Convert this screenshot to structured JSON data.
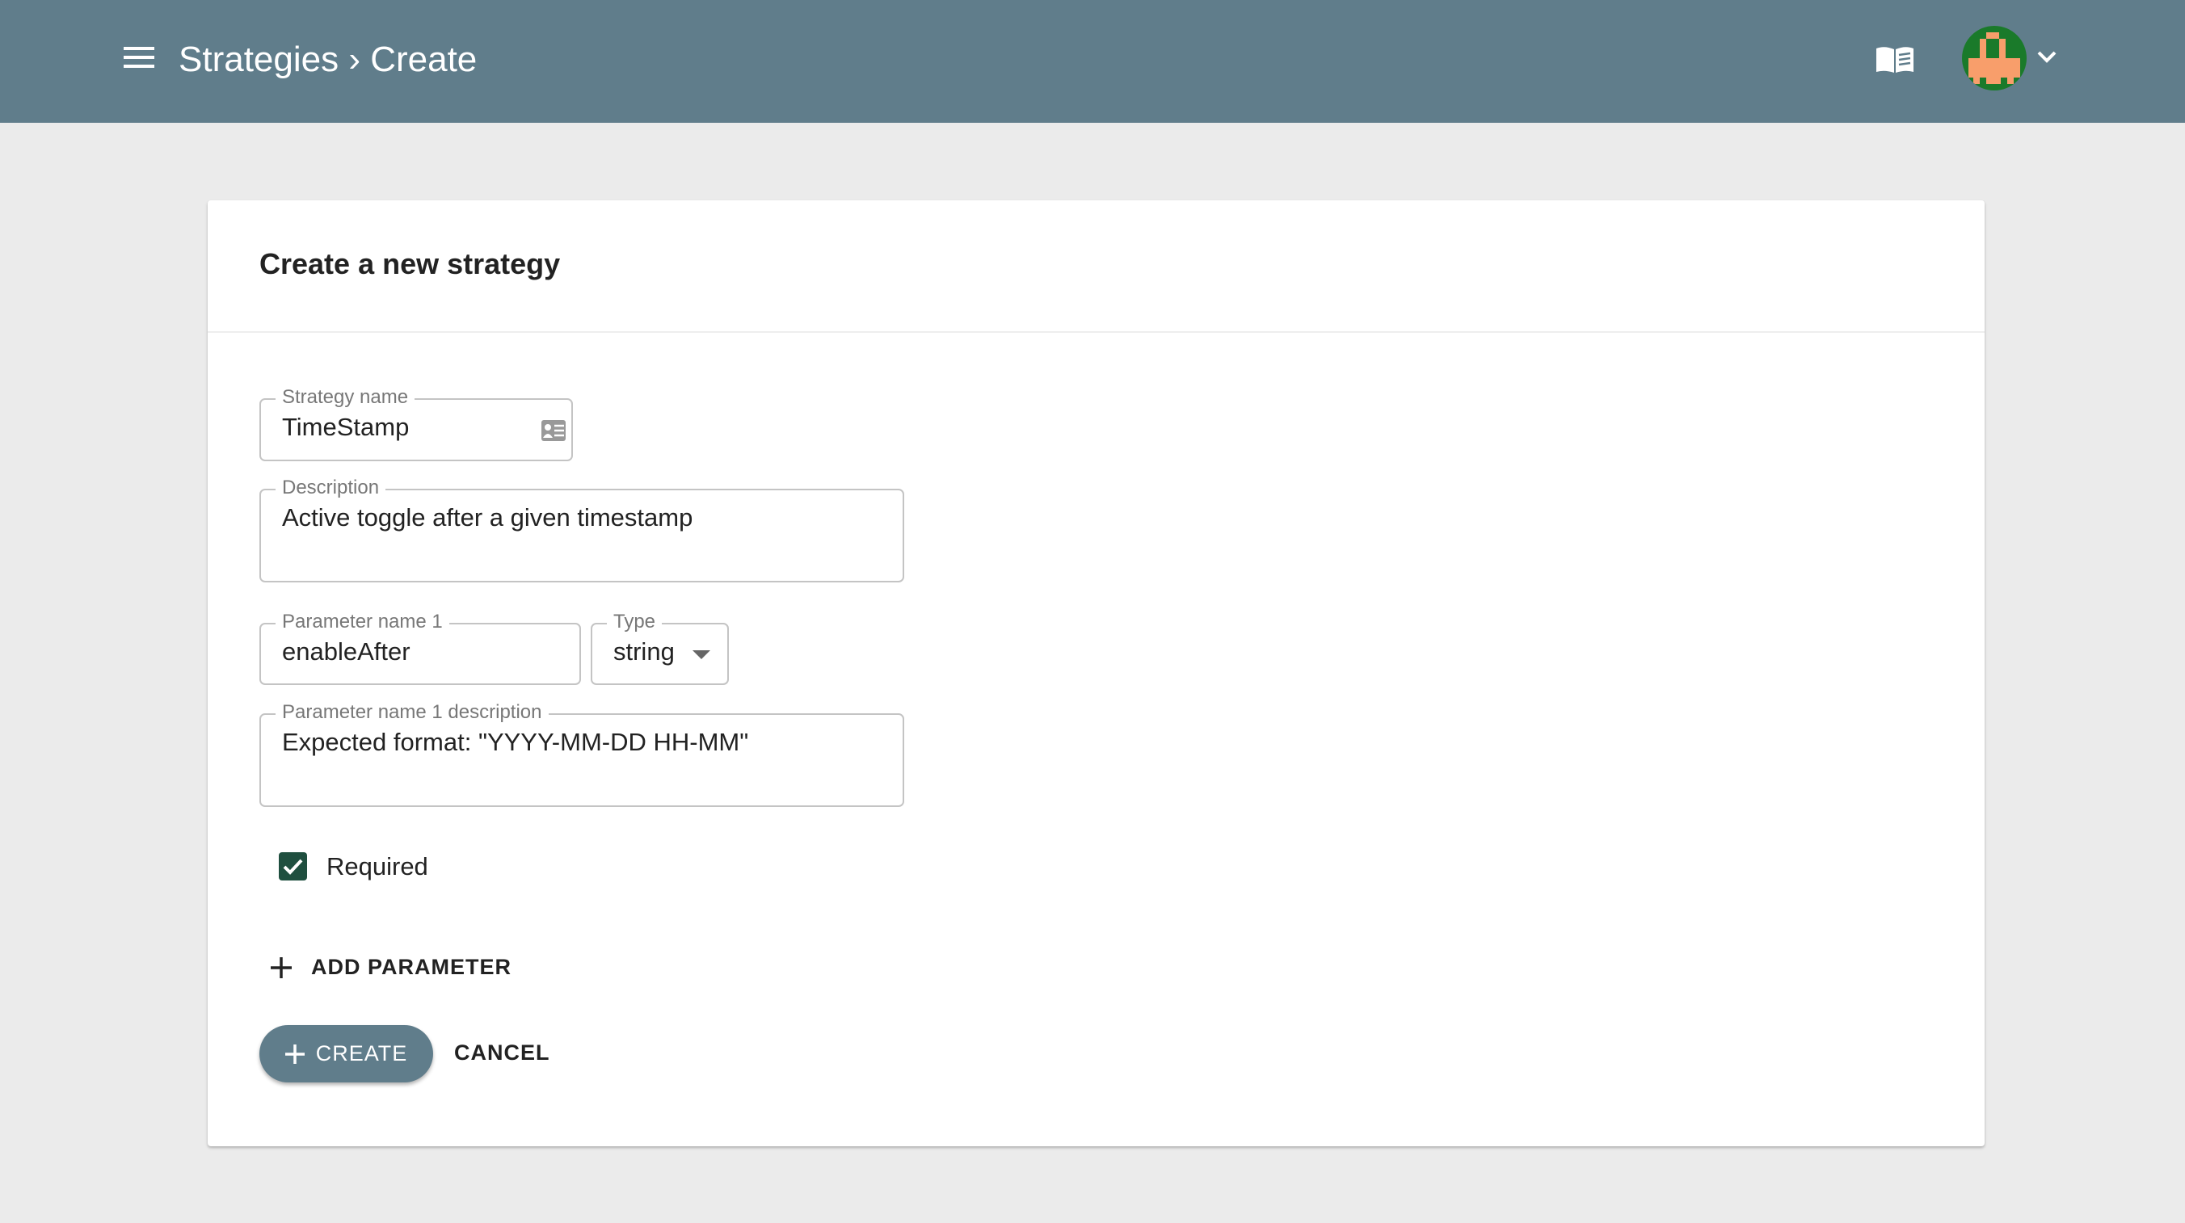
{
  "header": {
    "breadcrumb": "Strategies › Create",
    "menu_icon": "hamburger-icon",
    "docs_icon": "book-icon",
    "avatar_colors": {
      "bg": "#1a7a2a",
      "fg": "#f89e6b"
    }
  },
  "colors": {
    "primary": "#607d8b",
    "checkbox": "#1f4f3f",
    "background": "#ebebeb"
  },
  "card": {
    "title": "Create a new strategy"
  },
  "form": {
    "strategy_name": {
      "label": "Strategy name",
      "value": "TimeStamp"
    },
    "description": {
      "label": "Description",
      "value": "Active toggle after a given timestamp"
    },
    "param_name": {
      "label": "Parameter name 1",
      "value": "enableAfter"
    },
    "param_type": {
      "label": "Type",
      "value": "string"
    },
    "param_desc": {
      "label": "Parameter name 1 description",
      "value": "Expected format: \"YYYY-MM-DD HH-MM\""
    },
    "required": {
      "label": "Required",
      "checked": true
    }
  },
  "actions": {
    "add_parameter": "ADD PARAMETER",
    "create": "CREATE",
    "cancel": "CANCEL"
  }
}
